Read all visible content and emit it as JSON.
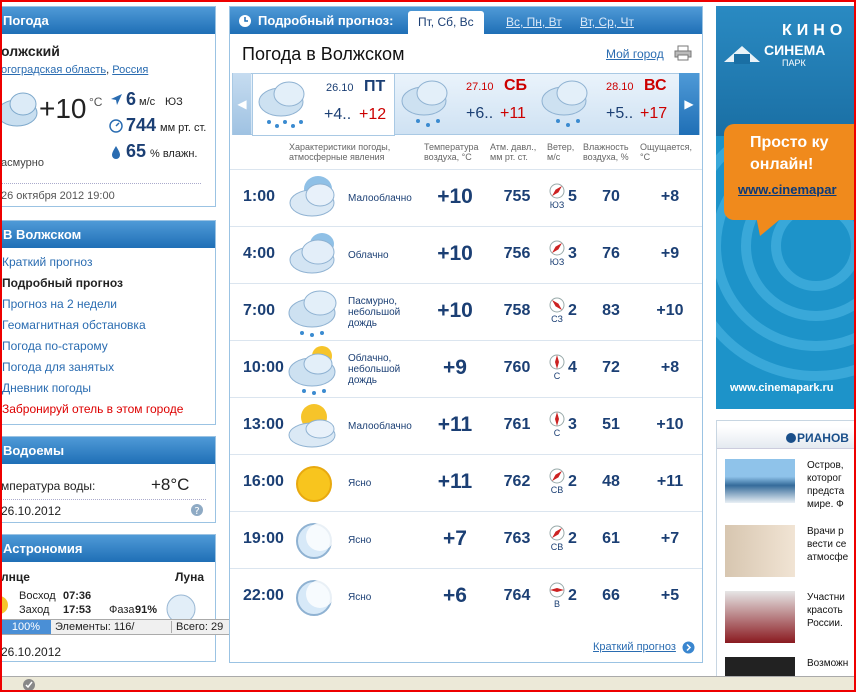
{
  "current": {
    "title": "Погода",
    "city": "олжский",
    "region": "огоградская область",
    "country": "Россия",
    "temp": "+10",
    "temp_unit": "°C",
    "wind_speed": "6",
    "wind_unit": "м/с",
    "wind_dir": "ЮЗ",
    "pressure": "744",
    "pressure_unit": "мм рт. ст.",
    "humidity": "65",
    "humidity_unit": "% влажн.",
    "condition": "асмурно",
    "updated": "26 октября 2012 19:00"
  },
  "city_menu": {
    "title": "В Волжском",
    "items": [
      "Краткий прогноз",
      "Подробный прогноз",
      "Прогноз на 2 недели",
      "Геомагнитная обстановка",
      "Погода по-старому",
      "Погода для занятых",
      "Дневник погоды"
    ],
    "hotel": "Забронируй отель в этом городе"
  },
  "water": {
    "title": "Водоемы",
    "label": "мпература воды:",
    "value": "+8°С",
    "date": "26.10.2012"
  },
  "astro": {
    "title": "Астрономия",
    "sun": "лнце",
    "moon": "Луна",
    "sunrise_label": "Восход",
    "sunrise": "07:36",
    "sunset_label": "Заход",
    "sunset": "17:53",
    "phase_label": "Фаза",
    "phase": "91%",
    "date": "26.10.2012"
  },
  "progressbar": {
    "pct": "100%",
    "elements": "Элементы: 116/",
    "total": "Всего: 29"
  },
  "main": {
    "head": "Подробный прогноз:",
    "tabs": [
      "Пт, Сб, Вс",
      "Вс, Пн, Вт",
      "Вт, Ср, Чт"
    ],
    "title": "Погода в Волжском",
    "my_city": "Мой город",
    "days": [
      {
        "date": "26.10",
        "dow": "ПТ",
        "tmin": "+4..",
        "tmax": "+12"
      },
      {
        "date": "27.10",
        "dow": "СБ",
        "tmin": "+6..",
        "tmax": "+11"
      },
      {
        "date": "28.10",
        "dow": "ВС",
        "tmin": "+5..",
        "tmax": "+17"
      }
    ],
    "columns": {
      "cond": "Характеристики погоды,\nатмосферные явления",
      "temp": "Температура\nвоздуха, °C",
      "press": "Атм. давл.,\nмм рт. ст.",
      "wind": "Ветер,\nм/с",
      "hum": "Влажность\nвоздуха, %",
      "feel": "Ощущается,\n°C"
    },
    "rows": [
      {
        "time": "1:00",
        "icon": "partly-cloudy-night-icon",
        "cond": "Малооблачно",
        "temp": "+10",
        "press": "755",
        "wind_dir": "ЮЗ",
        "wind": "5",
        "hum": "70",
        "feel": "+8"
      },
      {
        "time": "4:00",
        "icon": "cloudy-night-icon",
        "cond": "Облачно",
        "temp": "+10",
        "press": "756",
        "wind_dir": "ЮЗ",
        "wind": "3",
        "hum": "76",
        "feel": "+9"
      },
      {
        "time": "7:00",
        "icon": "overcast-rain-icon",
        "cond": "Пасмурно,\nнебольшой\nдождь",
        "temp": "+10",
        "press": "758",
        "wind_dir": "СЗ",
        "wind": "2",
        "hum": "83",
        "feel": "+10"
      },
      {
        "time": "10:00",
        "icon": "cloudy-sun-rain-icon",
        "cond": "Облачно,\nнебольшой\nдождь",
        "temp": "+9",
        "press": "760",
        "wind_dir": "С",
        "wind": "4",
        "hum": "72",
        "feel": "+8"
      },
      {
        "time": "13:00",
        "icon": "partly-cloudy-sun-icon",
        "cond": "Малооблачно",
        "temp": "+11",
        "press": "761",
        "wind_dir": "С",
        "wind": "3",
        "hum": "51",
        "feel": "+10"
      },
      {
        "time": "16:00",
        "icon": "sun-icon",
        "cond": "Ясно",
        "temp": "+11",
        "press": "762",
        "wind_dir": "СВ",
        "wind": "2",
        "hum": "48",
        "feel": "+11"
      },
      {
        "time": "19:00",
        "icon": "moon-icon",
        "cond": "Ясно",
        "temp": "+7",
        "press": "763",
        "wind_dir": "СВ",
        "wind": "2",
        "hum": "61",
        "feel": "+7"
      },
      {
        "time": "22:00",
        "icon": "moon-icon",
        "cond": "Ясно",
        "temp": "+6",
        "press": "764",
        "wind_dir": "В",
        "wind": "2",
        "hum": "66",
        "feel": "+5"
      }
    ],
    "short_link": "Краткий прогноз"
  },
  "ad": {
    "kino": "КИНО",
    "brand": "СИНЕМА",
    "brand_sub": "ПАРК",
    "promo": "Просто ку\nонлайн!",
    "promo_url": "www.cinemapar",
    "footer_url": "www.cinemapark.ru"
  },
  "news": {
    "brand": "РИАНОВ",
    "items": [
      "Остров,\nкоторог\nпредста\nмире. Ф",
      "Врачи р\nвести се\nатмосфе",
      "Участни\nкрасоть\nРоссии.",
      "Возможн"
    ]
  }
}
